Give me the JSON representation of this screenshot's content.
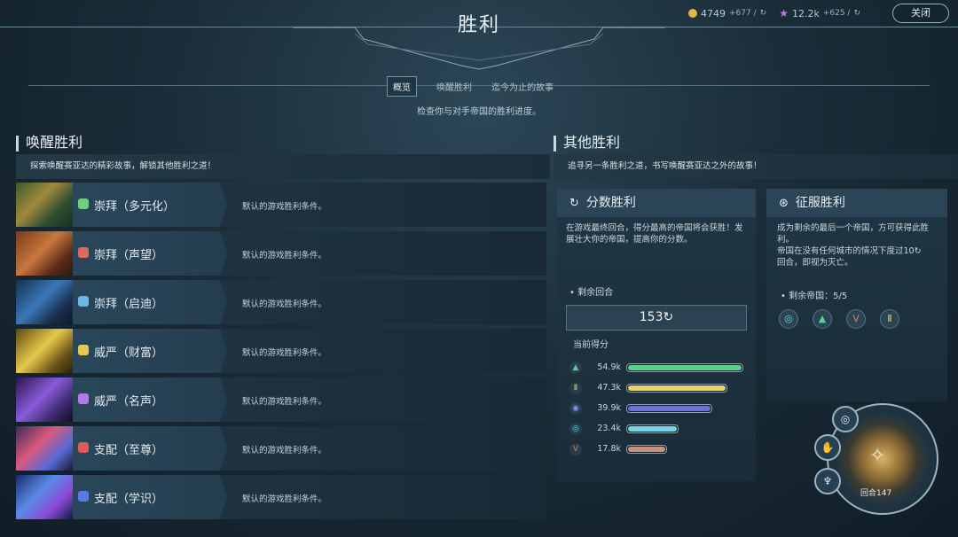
{
  "header": {
    "title": "胜利",
    "gold": "4749",
    "gold_rate": "+677 /",
    "influence": "12.2k",
    "influence_rate": "+625 /",
    "close_label": "关闭"
  },
  "tabs": [
    {
      "label": "概览",
      "active": true
    },
    {
      "label": "唤醒胜利",
      "active": false
    },
    {
      "label": "迄今为止的故事",
      "active": false
    }
  ],
  "subtitle": "检查你与对手帝国的胜利进度。",
  "awakening": {
    "heading": "唤醒胜利",
    "description": "探索唤醒赛亚达的精彩故事，解锁其他胜利之道！",
    "rows": [
      {
        "label": "崇拜（多元化）",
        "condition": "默认的游戏胜利条件。",
        "icon": "person-icon",
        "icon_color": "#6fcf7a"
      },
      {
        "label": "崇拜（声望）",
        "condition": "默认的游戏胜利条件。",
        "icon": "gear-icon",
        "icon_color": "#e06a5a"
      },
      {
        "label": "崇拜（启迪）",
        "condition": "默认的游戏胜利条件。",
        "icon": "swirl-icon",
        "icon_color": "#6ab8e8"
      },
      {
        "label": "威严（财富）",
        "condition": "默认的游戏胜利条件。",
        "icon": "coins-icon",
        "icon_color": "#e8c84a"
      },
      {
        "label": "威严（名声）",
        "condition": "默认的游戏胜利条件。",
        "icon": "blocks-icon",
        "icon_color": "#b27ae8"
      },
      {
        "label": "支配（至尊）",
        "condition": "默认的游戏胜利条件。",
        "icon": "orbs-icon",
        "icon_color": "#e0585a"
      },
      {
        "label": "支配（学识）",
        "condition": "默认的游戏胜利条件。",
        "icon": "book-icon",
        "icon_color": "#5a7ae8"
      }
    ]
  },
  "other": {
    "heading": "其他胜利",
    "description": "追寻另一条胜利之道，书写唤醒赛亚达之外的故事！",
    "score": {
      "title": "分数胜利",
      "text": "在游戏最终回合，得分最高的帝国将会获胜！发展壮大你的帝国，提高你的分数。",
      "remaining_label": "剩余回合",
      "remaining_value": "153",
      "current_label": "当前得分",
      "entries": [
        {
          "value": "54.9k",
          "fraction": 1.0,
          "color": "#5ad08a",
          "icon": "green-spire-icon",
          "icon_char": "▲",
          "icon_color": "#5ad08a"
        },
        {
          "value": "47.3k",
          "fraction": 0.86,
          "color": "#e6d26a",
          "icon": "gold-pillar-icon",
          "icon_char": "Ⅱ",
          "icon_color": "#e6d26a"
        },
        {
          "value": "39.9k",
          "fraction": 0.73,
          "color": "#6c72d8",
          "icon": "blue-emblem-icon",
          "icon_char": "◉",
          "icon_color": "#8a90ff"
        },
        {
          "value": "23.4k",
          "fraction": 0.43,
          "color": "#6fd6e6",
          "icon": "teal-orb-icon",
          "icon_char": "◎",
          "icon_color": "#6fd6e6"
        },
        {
          "value": "17.8k",
          "fraction": 0.33,
          "color": "#c9927a",
          "icon": "horns-icon",
          "icon_char": "V",
          "icon_color": "#e07a5a"
        }
      ]
    },
    "conquest": {
      "title": "征服胜利",
      "text1": "成为剩余的最后一个帝国，方可获得此胜利。",
      "text2": "帝国在没有任何城市的情况下度过10",
      "text3": "回合，即视为灭亡。",
      "remaining_label": "剩余帝国：5/5",
      "empires": [
        {
          "icon": "teal-orb-icon",
          "char": "◎",
          "color": "#6fd6e6"
        },
        {
          "icon": "green-spire-icon",
          "char": "▲",
          "color": "#5ad08a"
        },
        {
          "icon": "horns-icon",
          "char": "V",
          "color": "#e07a5a"
        },
        {
          "icon": "gold-pillar-icon",
          "char": "Ⅱ",
          "color": "#e6d26a"
        }
      ]
    }
  },
  "turn": {
    "label": "回合147"
  }
}
